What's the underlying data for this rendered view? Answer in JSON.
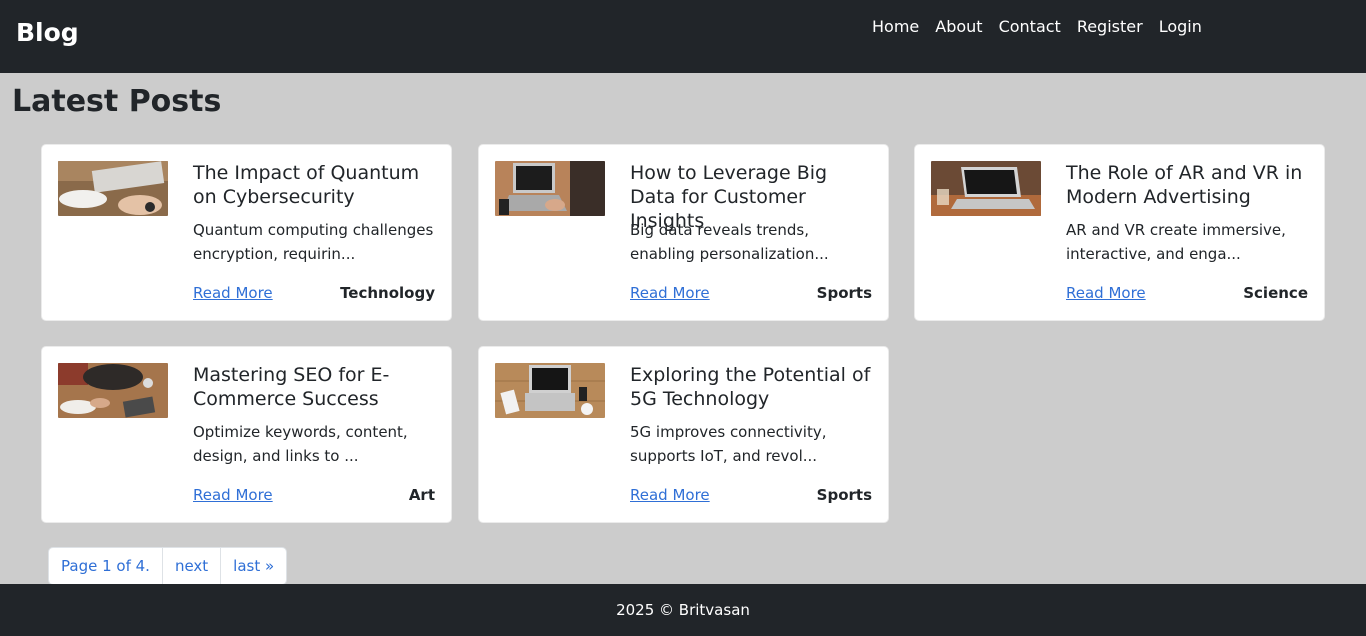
{
  "navbar": {
    "brand": "Blog",
    "links": [
      "Home",
      "About",
      "Contact",
      "Register",
      "Login"
    ]
  },
  "main": {
    "heading": "Latest Posts",
    "posts": [
      {
        "title": "The Impact of Quantum on Cybersecurity",
        "excerpt": "Quantum computing challenges encryption, requirin...",
        "read_more": "Read More",
        "category": "Technology"
      },
      {
        "title": "How to Leverage Big Data for Customer Insights",
        "excerpt": "Big data reveals trends, enabling personalization...",
        "read_more": "Read More",
        "category": "Sports"
      },
      {
        "title": "The Role of AR and VR in Modern Advertising",
        "excerpt": "AR and VR create immersive, interactive, and enga...",
        "read_more": "Read More",
        "category": "Science"
      },
      {
        "title": "Mastering SEO for E-Commerce Success",
        "excerpt": "Optimize keywords, content, design, and links to ...",
        "read_more": "Read More",
        "category": "Art"
      },
      {
        "title": "Exploring the Potential of 5G Technology",
        "excerpt": "5G improves connectivity, supports IoT, and revol...",
        "read_more": "Read More",
        "category": "Sports"
      }
    ]
  },
  "pagination": {
    "page_label": "Page 1 of 4.",
    "next_label": "next",
    "last_label": "last »"
  },
  "footer": {
    "text": "2025 © Britvasan"
  },
  "colors": {
    "navbar_bg": "#212529",
    "page_bg": "#cccccc",
    "link": "#2f6fd6"
  }
}
